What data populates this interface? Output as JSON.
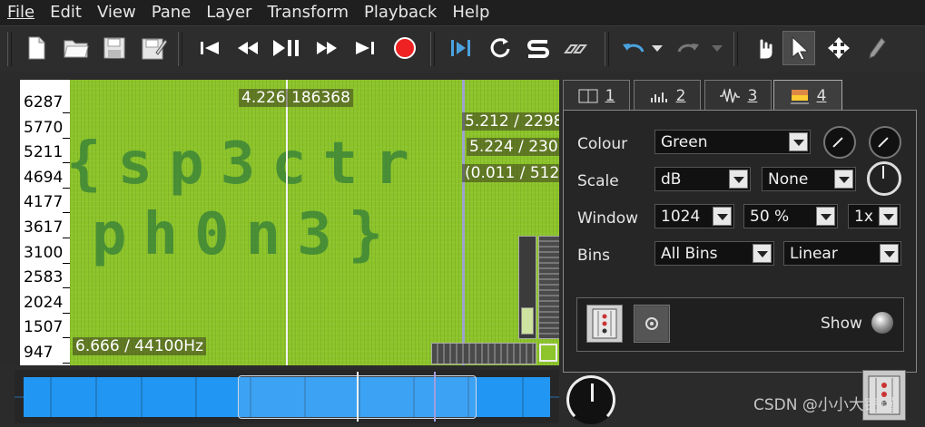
{
  "menu": [
    "File",
    "Edit",
    "View",
    "Pane",
    "Layer",
    "Transform",
    "Playback",
    "Help"
  ],
  "toolbar": {
    "buttons": [
      "new-file",
      "open-file",
      "save-file",
      "save-as",
      "rewind-start",
      "rewind",
      "play-pause",
      "fast-forward",
      "forward-end",
      "record",
      "play-selection",
      "loop",
      "solo",
      "follow-playback",
      "undo",
      "redo",
      "navigate",
      "select",
      "move",
      "draw"
    ]
  },
  "spectrogram": {
    "y_ticks": [
      "6287",
      "5770",
      "5211",
      "4694",
      "4177",
      "3617",
      "3100",
      "2583",
      "2024",
      "1507",
      "947"
    ],
    "cursor_label": "4.226",
    "cursor_value": "186368",
    "right_labels": [
      "5.212 / 2298",
      "5.224 / 230",
      "(0.011 / 512"
    ],
    "bottom_label": "6.666 / 44100Hz",
    "hidden_line1": "{sp3ctr",
    "hidden_line2": "ph0n3}",
    "bg_color": "#8cc42a"
  },
  "tabs": [
    {
      "num": "1",
      "icon": "panes-icon"
    },
    {
      "num": "2",
      "icon": "bars-icon"
    },
    {
      "num": "3",
      "icon": "waveform-icon"
    },
    {
      "num": "4",
      "icon": "spectrogram-icon",
      "active": true
    }
  ],
  "properties": {
    "colour_label": "Colour",
    "colour_value": "Green",
    "scale_label": "Scale",
    "scale_value": "dB",
    "scale_value2": "None",
    "window_label": "Window",
    "window_size": "1024",
    "window_overlap": "50 %",
    "window_oversample": "1x",
    "bins_label": "Bins",
    "bins_value": "All Bins",
    "bins_scale": "Linear",
    "show_label": "Show"
  },
  "watermark": "CSDN @小小大窃翼"
}
